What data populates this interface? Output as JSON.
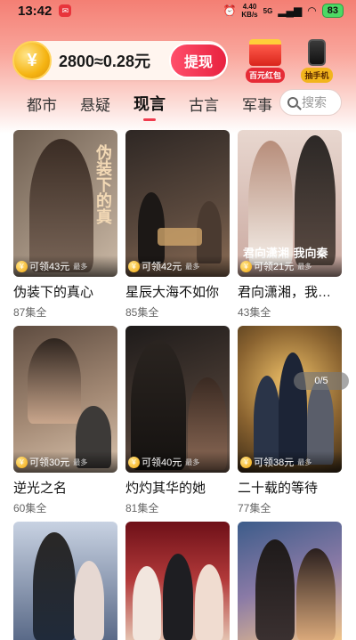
{
  "status_bar": {
    "time": "13:42",
    "net_speed": "4.40",
    "net_unit": "KB/s",
    "network": "5G",
    "battery": "83"
  },
  "rewards": {
    "balance_text": "2800≈0.28元",
    "coin_symbol": "¥",
    "withdraw_label": "提现",
    "promo_red_packet": "百元红包",
    "promo_phone": "抽手机"
  },
  "tabs": [
    {
      "label": "都市",
      "active": false
    },
    {
      "label": "悬疑",
      "active": false
    },
    {
      "label": "现言",
      "active": true
    },
    {
      "label": "古言",
      "active": false
    },
    {
      "label": "军事",
      "active": false
    }
  ],
  "search": {
    "placeholder": "搜索"
  },
  "coin_prefix": "可领",
  "coin_max": "最多",
  "page_indicator": "0/5",
  "dramas": [
    {
      "title": "伪装下的真心",
      "episodes": "87集全",
      "reward": "可领43元",
      "palette": [
        "#7a6a5a",
        "#c9b8a5"
      ]
    },
    {
      "title": "星辰大海不如你",
      "episodes": "85集全",
      "reward": "可领42元",
      "palette": [
        "#3a2e2a",
        "#8a6b55"
      ]
    },
    {
      "title": "君向潇湘，我向秦",
      "episodes": "43集全",
      "reward": "可领21元",
      "palette": [
        "#c9a7a0",
        "#f1e2d8"
      ]
    },
    {
      "title": "逆光之名",
      "episodes": "60集全",
      "reward": "可领30元",
      "palette": [
        "#6e5a4c",
        "#c4a993"
      ]
    },
    {
      "title": "灼灼其华的她",
      "episodes": "81集全",
      "reward": "可领40元",
      "palette": [
        "#2b2624",
        "#6b5448"
      ]
    },
    {
      "title": "二十载的等待",
      "episodes": "77集全",
      "reward": "可领38元",
      "palette": [
        "#4a3a22",
        "#c89a45"
      ]
    },
    {
      "title": "",
      "episodes": "",
      "reward": "",
      "palette": [
        "#5a6a88",
        "#c8d2e2"
      ]
    },
    {
      "title": "",
      "episodes": "",
      "reward": "",
      "palette": [
        "#9a1e2a",
        "#e4c2b0"
      ]
    },
    {
      "title": "",
      "episodes": "",
      "reward": "",
      "palette": [
        "#3c5c8a",
        "#f0c48a"
      ]
    }
  ],
  "poster_text": {
    "card1": "伪装下的真",
    "card3": "君向潇湘 我向秦"
  }
}
